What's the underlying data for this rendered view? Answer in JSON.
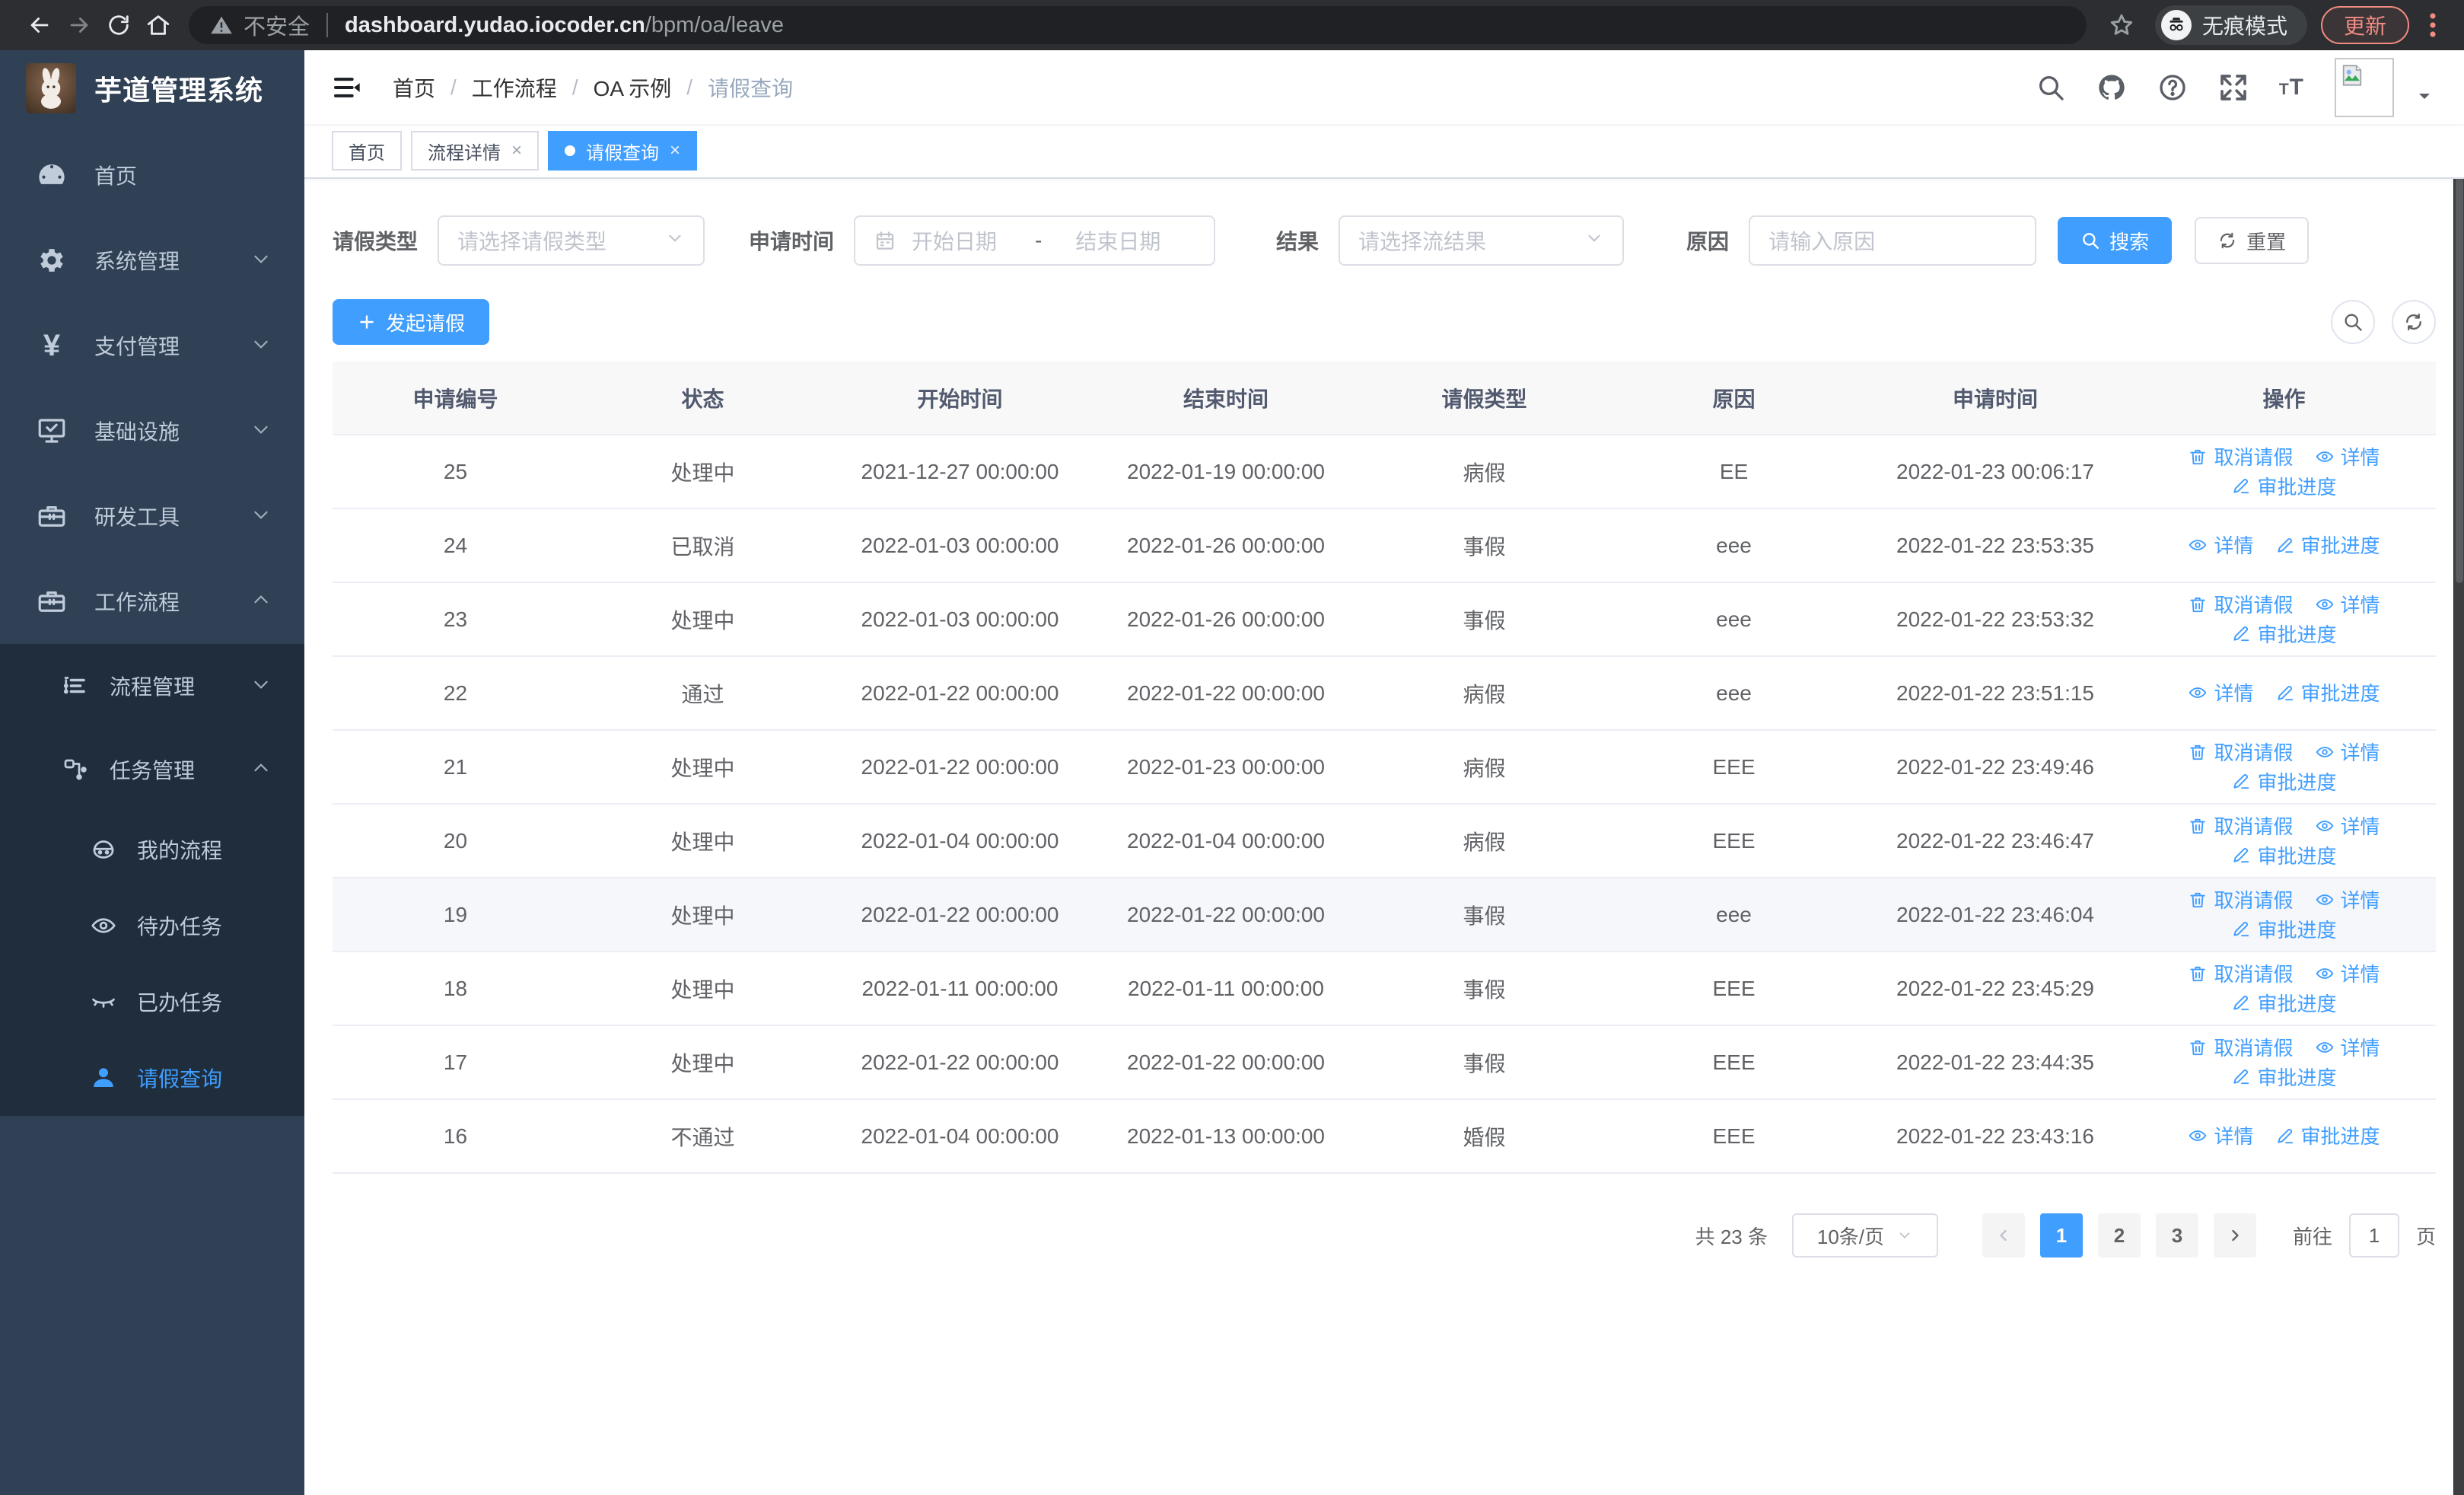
{
  "browser": {
    "security_label": "不安全",
    "url_host": "dashboard.yudao.iocoder.cn",
    "url_path": "/bpm/oa/leave",
    "incognito_label": "无痕模式",
    "update_label": "更新"
  },
  "sidebar": {
    "app_title": "芋道管理系统",
    "items": [
      {
        "label": "首页",
        "icon": "dashboard-icon",
        "expandable": false
      },
      {
        "label": "系统管理",
        "icon": "gear-icon",
        "expandable": true,
        "expanded": false
      },
      {
        "label": "支付管理",
        "icon": "yen-icon",
        "expandable": true,
        "expanded": false
      },
      {
        "label": "基础设施",
        "icon": "infra-icon",
        "expandable": true,
        "expanded": false
      },
      {
        "label": "研发工具",
        "icon": "toolbox-icon",
        "expandable": true,
        "expanded": false
      },
      {
        "label": "工作流程",
        "icon": "briefcase-icon",
        "expandable": true,
        "expanded": true
      }
    ],
    "submenu": [
      {
        "label": "流程管理",
        "icon": "tree-list-icon",
        "expanded": false
      },
      {
        "label": "任务管理",
        "icon": "share-nodes-icon",
        "expanded": true
      }
    ],
    "task_items": [
      {
        "label": "我的流程",
        "icon": "robot-icon",
        "active": false
      },
      {
        "label": "待办任务",
        "icon": "eye-icon",
        "active": false
      },
      {
        "label": "已办任务",
        "icon": "eye-closed-icon",
        "active": false
      },
      {
        "label": "请假查询",
        "icon": "user-icon",
        "active": true
      }
    ]
  },
  "navbar": {
    "breadcrumb": [
      "首页",
      "工作流程",
      "OA 示例",
      "请假查询"
    ]
  },
  "tabs": [
    {
      "label": "首页",
      "closable": false,
      "active": false
    },
    {
      "label": "流程详情",
      "closable": true,
      "active": false
    },
    {
      "label": "请假查询",
      "closable": true,
      "active": true
    }
  ],
  "filters": {
    "leave_type_label": "请假类型",
    "leave_type_placeholder": "请选择请假类型",
    "apply_time_label": "申请时间",
    "date_start_placeholder": "开始日期",
    "date_separator": "-",
    "date_end_placeholder": "结束日期",
    "result_label": "结果",
    "result_placeholder": "请选择流结果",
    "reason_label": "原因",
    "reason_placeholder": "请输入原因",
    "search_button": "搜索",
    "reset_button": "重置"
  },
  "toolbar": {
    "create_button": "发起请假"
  },
  "table": {
    "columns": [
      "申请编号",
      "状态",
      "开始时间",
      "结束时间",
      "请假类型",
      "原因",
      "申请时间",
      "操作"
    ],
    "action_labels": {
      "cancel": "取消请假",
      "detail": "详情",
      "progress": "审批进度"
    },
    "rows": [
      {
        "id": "25",
        "status": "处理中",
        "start": "2021-12-27 00:00:00",
        "end": "2022-01-19 00:00:00",
        "type": "病假",
        "reason": "EE",
        "applied": "2022-01-23 00:06:17",
        "cancelable": true,
        "highlighted": false
      },
      {
        "id": "24",
        "status": "已取消",
        "start": "2022-01-03 00:00:00",
        "end": "2022-01-26 00:00:00",
        "type": "事假",
        "reason": "eee",
        "applied": "2022-01-22 23:53:35",
        "cancelable": false,
        "highlighted": false
      },
      {
        "id": "23",
        "status": "处理中",
        "start": "2022-01-03 00:00:00",
        "end": "2022-01-26 00:00:00",
        "type": "事假",
        "reason": "eee",
        "applied": "2022-01-22 23:53:32",
        "cancelable": true,
        "highlighted": false
      },
      {
        "id": "22",
        "status": "通过",
        "start": "2022-01-22 00:00:00",
        "end": "2022-01-22 00:00:00",
        "type": "病假",
        "reason": "eee",
        "applied": "2022-01-22 23:51:15",
        "cancelable": false,
        "highlighted": false
      },
      {
        "id": "21",
        "status": "处理中",
        "start": "2022-01-22 00:00:00",
        "end": "2022-01-23 00:00:00",
        "type": "病假",
        "reason": "EEE",
        "applied": "2022-01-22 23:49:46",
        "cancelable": true,
        "highlighted": false
      },
      {
        "id": "20",
        "status": "处理中",
        "start": "2022-01-04 00:00:00",
        "end": "2022-01-04 00:00:00",
        "type": "病假",
        "reason": "EEE",
        "applied": "2022-01-22 23:46:47",
        "cancelable": true,
        "highlighted": false
      },
      {
        "id": "19",
        "status": "处理中",
        "start": "2022-01-22 00:00:00",
        "end": "2022-01-22 00:00:00",
        "type": "事假",
        "reason": "eee",
        "applied": "2022-01-22 23:46:04",
        "cancelable": true,
        "highlighted": true
      },
      {
        "id": "18",
        "status": "处理中",
        "start": "2022-01-11 00:00:00",
        "end": "2022-01-11 00:00:00",
        "type": "事假",
        "reason": "EEE",
        "applied": "2022-01-22 23:45:29",
        "cancelable": true,
        "highlighted": false
      },
      {
        "id": "17",
        "status": "处理中",
        "start": "2022-01-22 00:00:00",
        "end": "2022-01-22 00:00:00",
        "type": "事假",
        "reason": "EEE",
        "applied": "2022-01-22 23:44:35",
        "cancelable": true,
        "highlighted": false
      },
      {
        "id": "16",
        "status": "不通过",
        "start": "2022-01-04 00:00:00",
        "end": "2022-01-13 00:00:00",
        "type": "婚假",
        "reason": "EEE",
        "applied": "2022-01-22 23:43:16",
        "cancelable": false,
        "highlighted": false
      }
    ]
  },
  "pagination": {
    "total_text": "共 23 条",
    "page_size": "10条/页",
    "pages": [
      "1",
      "2",
      "3"
    ],
    "active_page": "1",
    "goto_label": "前往",
    "goto_value": "1",
    "page_suffix": "页"
  },
  "colors": {
    "accent": "#409eff",
    "sidebar_bg": "#304156",
    "submenu_bg": "#1f2d3d",
    "update_button": "#f28b82"
  }
}
